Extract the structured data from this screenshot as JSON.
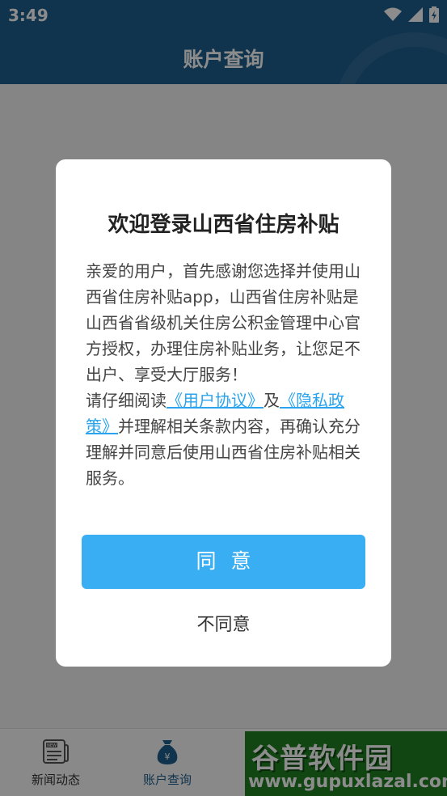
{
  "status_bar": {
    "time": "3:49"
  },
  "header": {
    "title": "账户查询"
  },
  "bottom_nav": {
    "items": [
      {
        "label": "新闻动态",
        "icon": "newspaper-icon"
      },
      {
        "label": "账户查询",
        "icon": "money-bag-icon"
      }
    ]
  },
  "watermark": {
    "logo": "谷普软件园",
    "url": "www.gupuxlazal.com"
  },
  "dialog": {
    "title": "欢迎登录山西省住房补贴",
    "para1": "亲爱的用户，首先感谢您选择并使用山西省住房补贴app，山西省住房补贴是山西省省级机关住房公积金管理中心官方授权，办理住房补贴业务，让您足不出户、享受大厅服务！",
    "para2_prefix": "请仔细阅读",
    "user_agreement_link": "《用户协议》",
    "and": "及",
    "privacy_policy_link": "《隐私政策》",
    "para2_suffix": "并理解相关条款内容，再确认充分理解并同意后使用山西省住房补贴相关服务。",
    "agree_button": "同意",
    "disagree_button": "不同意"
  },
  "colors": {
    "header_bg": "#1e5f8c",
    "accent": "#3aaef3",
    "link": "#2aa4ee"
  }
}
